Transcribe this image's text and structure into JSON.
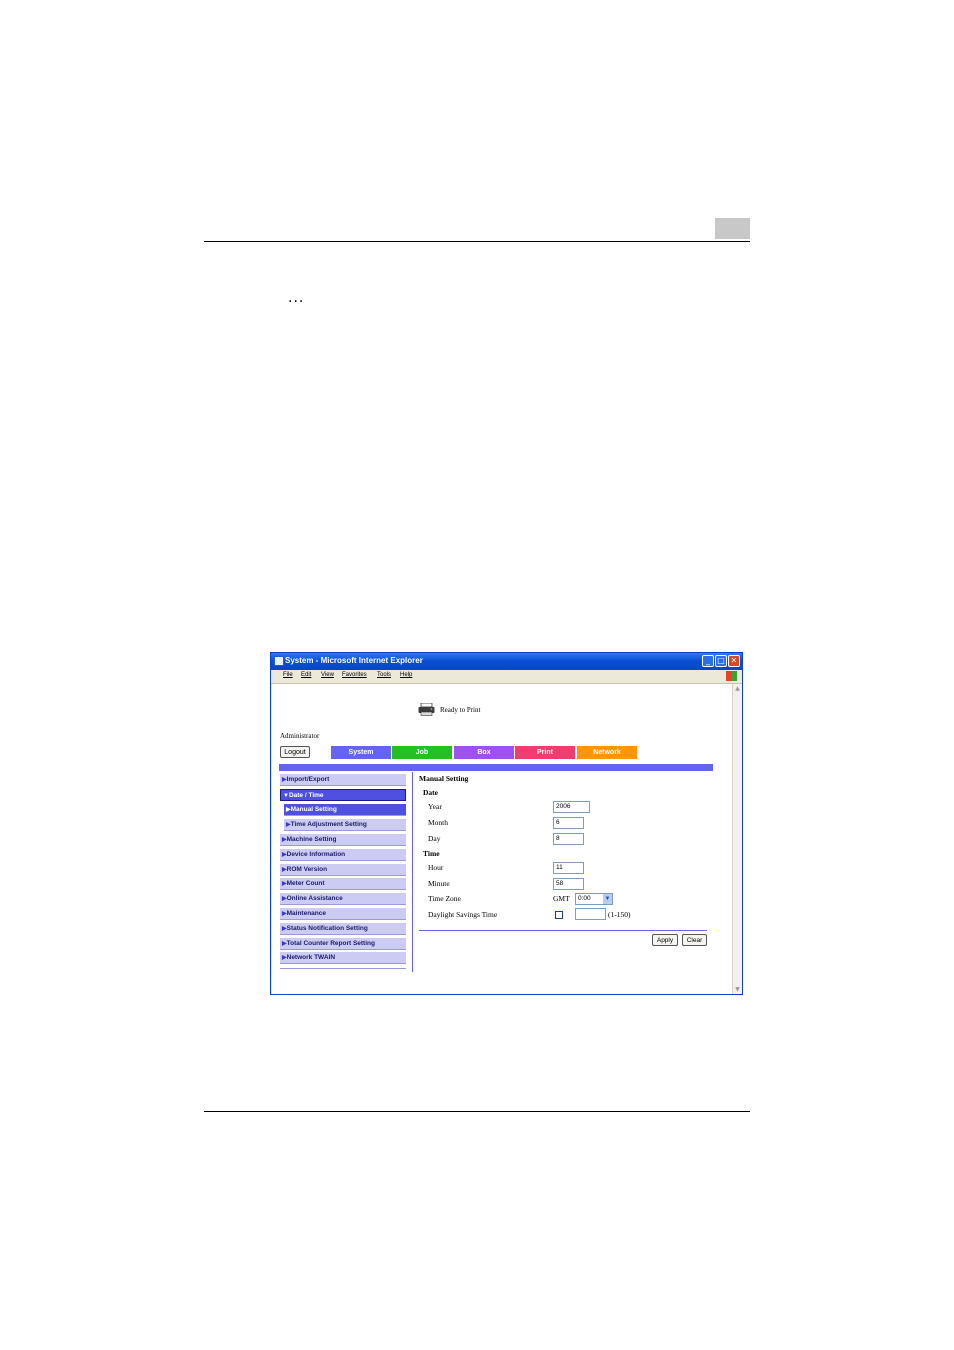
{
  "document": {
    "continuation_marker": "..."
  },
  "window": {
    "title": "System - Microsoft Internet Explorer",
    "controls": {
      "minimize": "_",
      "maximize": "□",
      "close": "✕"
    },
    "menu": [
      "File",
      "Edit",
      "View",
      "Favorites",
      "Tools",
      "Help"
    ]
  },
  "app": {
    "status": "Ready to Print",
    "user": "Administrator",
    "logout_label": "Logout",
    "tabs": [
      {
        "label": "System",
        "color": "#6464f0"
      },
      {
        "label": "Job",
        "color": "#22c022"
      },
      {
        "label": "Box",
        "color": "#a050f0"
      },
      {
        "label": "Print",
        "color": "#f03c6e"
      },
      {
        "label": "Network",
        "color": "#ff9600"
      }
    ],
    "sidebar": [
      "Import/Export",
      "Date / Time",
      "Manual Setting",
      "Time Adjustment Setting",
      "Machine Setting",
      "Device Information",
      "ROM Version",
      "Meter Count",
      "Online Assistance",
      "Maintenance",
      "Status Notification Setting",
      "Total Counter Report Setting",
      "Network TWAIN"
    ],
    "form": {
      "title": "Manual Setting",
      "date_group": "Date",
      "year_label": "Year",
      "year_value": "2006",
      "month_label": "Month",
      "month_value": "6",
      "day_label": "Day",
      "day_value": "8",
      "time_group": "Time",
      "hour_label": "Hour",
      "hour_value": "11",
      "minute_label": "Minute",
      "minute_value": "58",
      "timezone_label": "Time Zone",
      "gmt_prefix": "GMT",
      "timezone_value": "0:00",
      "dst_label": "Daylight Savings Time",
      "dst_range": "(1-150)",
      "dst_value": ""
    },
    "apply_label": "Apply",
    "clear_label": "Clear"
  }
}
